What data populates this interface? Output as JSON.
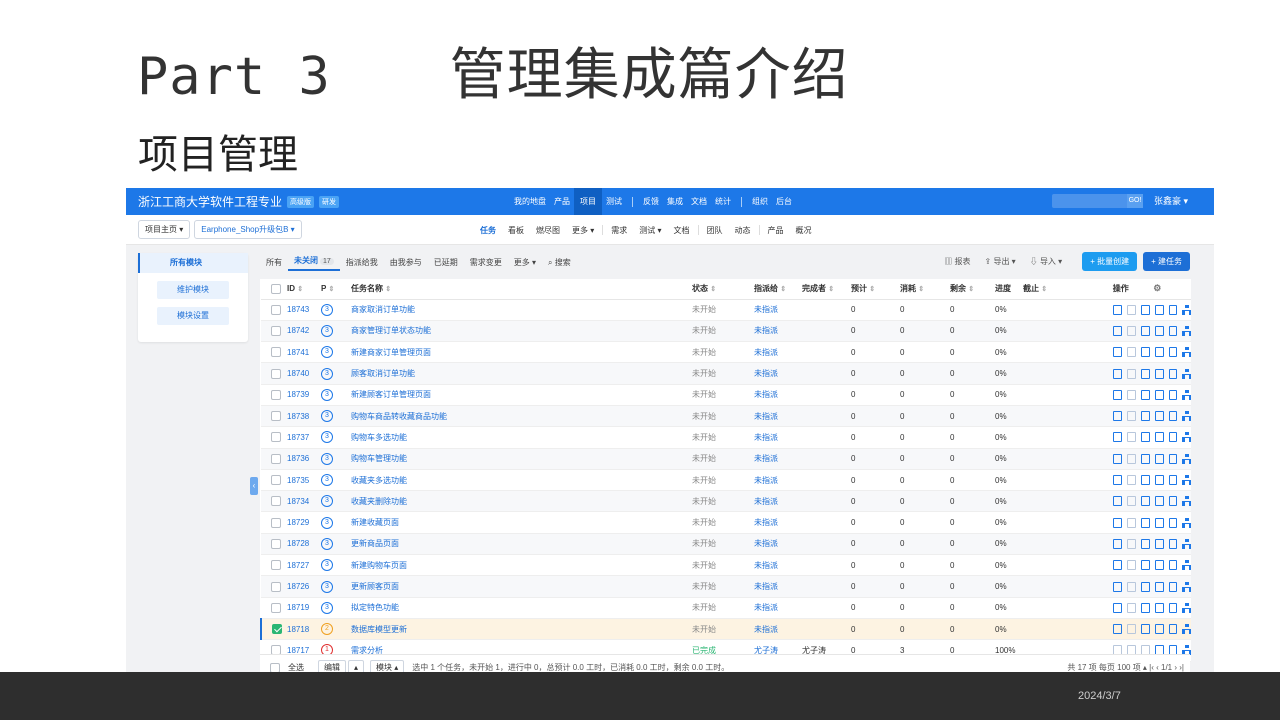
{
  "slide": {
    "part": "Part 3",
    "title": "管理集成篇介绍",
    "subtitle": "项目管理",
    "date": "2024/3/7"
  },
  "app": {
    "brand": "浙江工商大学软件工程专业",
    "badges": [
      "高级版",
      "研发"
    ],
    "main_nav": [
      "我的地盘",
      "产品",
      "项目",
      "测试",
      "反馈",
      "集成",
      "文档",
      "统计",
      "组织",
      "后台"
    ],
    "main_nav_active": "项目",
    "go_label": "GO!",
    "user": "张鑫豪 ▾",
    "crumb_home": "项目主页 ▾",
    "crumb_product": "Earphone_Shop升级包B ▾",
    "sub_nav": [
      "任务",
      "看板",
      "燃尽图",
      "更多 ▾",
      "需求",
      "测试 ▾",
      "文档",
      "团队",
      "动态",
      "产品",
      "概况"
    ],
    "sidebar": {
      "head": "所有模块",
      "buttons": [
        "维护模块",
        "模块设置"
      ]
    },
    "filters": {
      "tabs": [
        "所有",
        "未关闭",
        "指派给我",
        "由我参与",
        "已延期",
        "需求变更",
        "更多 ▾",
        "搜索"
      ],
      "active": "未关闭",
      "unclosed_count": "17",
      "search_icon": "search-icon"
    },
    "actions": {
      "report": "报表",
      "export": "导出 ▾",
      "import": "导入 ▾",
      "batch_create": "+ 批量创建",
      "create_task": "+ 建任务"
    },
    "columns": [
      "ID",
      "P",
      "任务名称",
      "状态",
      "指派给",
      "完成者",
      "预计",
      "消耗",
      "剩余",
      "进度",
      "截止",
      "操作"
    ],
    "rows": [
      {
        "id": "18743",
        "p": "3",
        "name": "商家取消订单功能",
        "status": "未开始",
        "assign": "未指派",
        "finisher": "",
        "est": "0",
        "cons": "0",
        "left": "0",
        "progress": "0%"
      },
      {
        "id": "18742",
        "p": "3",
        "name": "商家管理订单状态功能",
        "status": "未开始",
        "assign": "未指派",
        "finisher": "",
        "est": "0",
        "cons": "0",
        "left": "0",
        "progress": "0%"
      },
      {
        "id": "18741",
        "p": "3",
        "name": "新建商家订单管理页面",
        "status": "未开始",
        "assign": "未指派",
        "finisher": "",
        "est": "0",
        "cons": "0",
        "left": "0",
        "progress": "0%"
      },
      {
        "id": "18740",
        "p": "3",
        "name": "顾客取消订单功能",
        "status": "未开始",
        "assign": "未指派",
        "finisher": "",
        "est": "0",
        "cons": "0",
        "left": "0",
        "progress": "0%"
      },
      {
        "id": "18739",
        "p": "3",
        "name": "新建顾客订单管理页面",
        "status": "未开始",
        "assign": "未指派",
        "finisher": "",
        "est": "0",
        "cons": "0",
        "left": "0",
        "progress": "0%"
      },
      {
        "id": "18738",
        "p": "3",
        "name": "购物车商品转收藏商品功能",
        "status": "未开始",
        "assign": "未指派",
        "finisher": "",
        "est": "0",
        "cons": "0",
        "left": "0",
        "progress": "0%"
      },
      {
        "id": "18737",
        "p": "3",
        "name": "购物车多选功能",
        "status": "未开始",
        "assign": "未指派",
        "finisher": "",
        "est": "0",
        "cons": "0",
        "left": "0",
        "progress": "0%"
      },
      {
        "id": "18736",
        "p": "3",
        "name": "购物车管理功能",
        "status": "未开始",
        "assign": "未指派",
        "finisher": "",
        "est": "0",
        "cons": "0",
        "left": "0",
        "progress": "0%"
      },
      {
        "id": "18735",
        "p": "3",
        "name": "收藏夹多选功能",
        "status": "未开始",
        "assign": "未指派",
        "finisher": "",
        "est": "0",
        "cons": "0",
        "left": "0",
        "progress": "0%"
      },
      {
        "id": "18734",
        "p": "3",
        "name": "收藏夹删除功能",
        "status": "未开始",
        "assign": "未指派",
        "finisher": "",
        "est": "0",
        "cons": "0",
        "left": "0",
        "progress": "0%"
      },
      {
        "id": "18729",
        "p": "3",
        "name": "新建收藏页面",
        "status": "未开始",
        "assign": "未指派",
        "finisher": "",
        "est": "0",
        "cons": "0",
        "left": "0",
        "progress": "0%"
      },
      {
        "id": "18728",
        "p": "3",
        "name": "更新商品页面",
        "status": "未开始",
        "assign": "未指派",
        "finisher": "",
        "est": "0",
        "cons": "0",
        "left": "0",
        "progress": "0%"
      },
      {
        "id": "18727",
        "p": "3",
        "name": "新建购物车页面",
        "status": "未开始",
        "assign": "未指派",
        "finisher": "",
        "est": "0",
        "cons": "0",
        "left": "0",
        "progress": "0%"
      },
      {
        "id": "18726",
        "p": "3",
        "name": "更新顾客页面",
        "status": "未开始",
        "assign": "未指派",
        "finisher": "",
        "est": "0",
        "cons": "0",
        "left": "0",
        "progress": "0%"
      },
      {
        "id": "18719",
        "p": "3",
        "name": "拟定特色功能",
        "status": "未开始",
        "assign": "未指派",
        "finisher": "",
        "est": "0",
        "cons": "0",
        "left": "0",
        "progress": "0%"
      },
      {
        "id": "18718",
        "p": "2",
        "name": "数据库模型更新",
        "status": "未开始",
        "assign": "未指派",
        "finisher": "",
        "est": "0",
        "cons": "0",
        "left": "0",
        "progress": "0%",
        "selected": true
      },
      {
        "id": "18717",
        "p": "1",
        "name": "需求分析",
        "status": "已完成",
        "assign": "尤子涛",
        "finisher": "尤子涛",
        "est": "0",
        "cons": "3",
        "left": "0",
        "progress": "100%"
      }
    ],
    "footer": {
      "select_all": "全选",
      "edit": "编辑",
      "caret": "▴",
      "module": "模块 ▴",
      "summary": "选中 1 个任务，未开始 1，进行中 0，总预计 0.0 工时，已消耗 0.0 工时，剩余 0.0 工时。",
      "pager": "共 17 项  每页 100 项 ▴  |‹  ‹  1/1  ›  ›|"
    },
    "colors": {
      "topbar": "#1d78e8",
      "accent": "#1d6fd6",
      "done": "#2bb673"
    }
  }
}
